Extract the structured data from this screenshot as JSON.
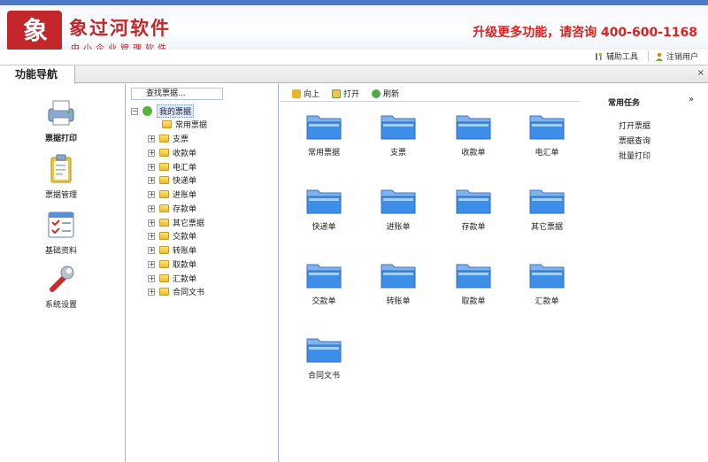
{
  "header": {
    "logo_mark": "象",
    "title": "象过河软件",
    "subtitle": "中小企业管理软件",
    "promo": "升级更多功能，请咨询 400-600-1168"
  },
  "topbar": {
    "tools_label": "辅助工具",
    "logout_label": "注销用户"
  },
  "tab": {
    "label": "功能导航",
    "close": "×"
  },
  "nav": [
    {
      "label": "票据打印",
      "icon": "printer-icon"
    },
    {
      "label": "票据管理",
      "icon": "clipboard-icon"
    },
    {
      "label": "基础资料",
      "icon": "checklist-icon"
    },
    {
      "label": "系统设置",
      "icon": "wrench-icon"
    }
  ],
  "tree": {
    "search_placeholder": "查找票据...",
    "root": "我的票据",
    "items": [
      "常用票据",
      "支票",
      "收款单",
      "电汇单",
      "快递单",
      "进账单",
      "存款单",
      "其它票据",
      "交款单",
      "转账单",
      "取款单",
      "汇款单",
      "合同文书"
    ]
  },
  "actions": {
    "up": "向上",
    "open": "打开",
    "refresh": "刷新"
  },
  "folders": [
    "常用票据",
    "支票",
    "收款单",
    "电汇单",
    "快递单",
    "进账单",
    "存款单",
    "其它票据",
    "交款单",
    "转账单",
    "取款单",
    "汇款单",
    "合同文书"
  ],
  "tasks": {
    "title": "常用任务",
    "collapse": "»",
    "items": [
      "打开票据",
      "票据查询",
      "批量打印"
    ]
  },
  "colors": {
    "brand_red": "#c3272b",
    "promo_red": "#e02020",
    "header_blue": "#4c79c9",
    "folder_blue": "#3d8ee8"
  }
}
